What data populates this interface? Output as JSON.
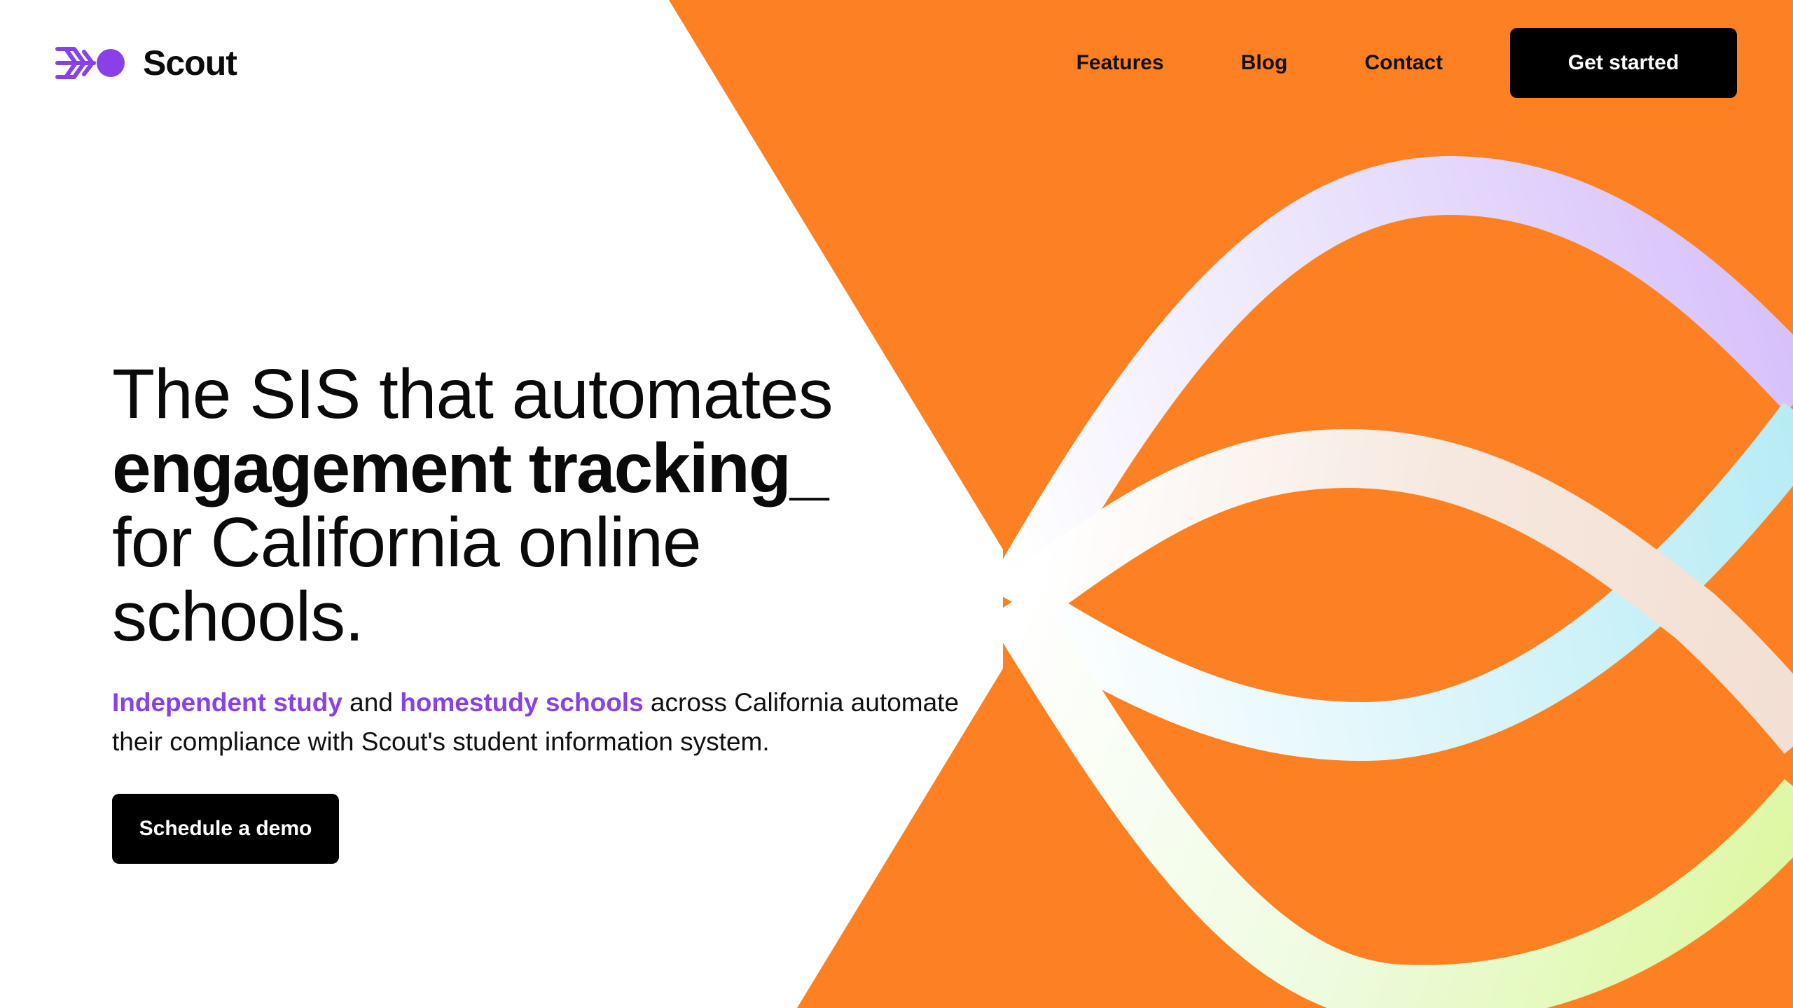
{
  "brand": {
    "name": "Scout",
    "logo_icon": "scout-logo-mark",
    "accent_color": "#8a40e8",
    "hero_background_color": "#fd8123"
  },
  "nav": {
    "items": [
      {
        "label": "Features"
      },
      {
        "label": "Blog"
      },
      {
        "label": "Contact"
      }
    ],
    "cta_label": "Get started"
  },
  "hero": {
    "headline": {
      "line1": "The SIS that automates",
      "line2": "engagement tracking_",
      "line3": "for California online",
      "line4": "schools."
    },
    "subtext": {
      "highlight1": "Independent study",
      "connector": " and ",
      "highlight2": "homestudy schools",
      "rest": " across California automate their compliance with Scout's student information system."
    },
    "cta_label": "Schedule a demo"
  }
}
